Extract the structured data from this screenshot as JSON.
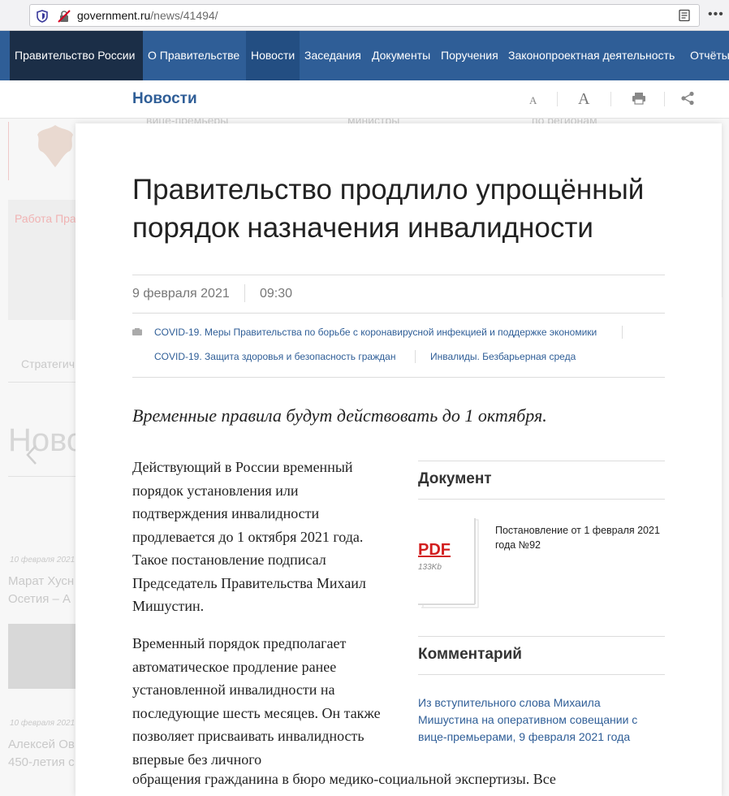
{
  "browser": {
    "url_domain": "government.ru",
    "url_path": "/news/41494/",
    "more_label": "•••"
  },
  "nav": {
    "home": "Правительство России",
    "items": [
      "О Правительстве",
      "Новости",
      "Заседания",
      "Документы",
      "Поручения",
      "Законопроектная деятельность",
      "Отчёты"
    ]
  },
  "subheader": {
    "section": "Новости",
    "font_small": "A",
    "font_large": "A"
  },
  "background": {
    "items": [
      "вице-премьеры",
      "министры",
      "по регионам",
      "Работа Пра",
      "Стратегич",
      "Ново",
      "10 февраля 2021",
      "Марат Хусн",
      "Осетия – А",
      "10 февраля 2021",
      "Алексей Ов",
      "450-летия с"
    ]
  },
  "article": {
    "title": "Правительство продлило упрощённый порядок назначения инвалидности",
    "date": "9 февраля 2021",
    "time": "09:30",
    "tags": [
      "COVID-19. Меры Правительства по борьбе с коронавирусной инфекцией и поддержке экономики",
      "COVID-19. Защита здоровья и безопасность граждан",
      "Инвалиды. Безбарьерная среда"
    ],
    "lead": "Временные правила будут действовать до 1 октября.",
    "p1": "Действующий в России временный порядок установления или подтверждения инвалидности продлевается до 1 октября 2021 года. Такое постановление подписал Председатель Правительства Михаил Мишустин.",
    "p2": "Временный порядок предполагает автоматическое продление ранее установленной инвалидности на последующие шесть месяцев. Он также позволяет присваивать инвалидность впервые без личного",
    "p3": "обращения гражданина в бюро медико-социальной экспертизы. Все"
  },
  "sidebar": {
    "document_heading": "Документ",
    "pdf_label": "PDF",
    "pdf_size": "133Kb",
    "document_title": "Постановление от 1 февраля 2021 года №92",
    "comment_heading": "Комментарий",
    "comment_link": "Из вступительного слова Михаила Мишустина на оперативном совещании с вице-премьерами, 9 февраля 2021 года"
  }
}
